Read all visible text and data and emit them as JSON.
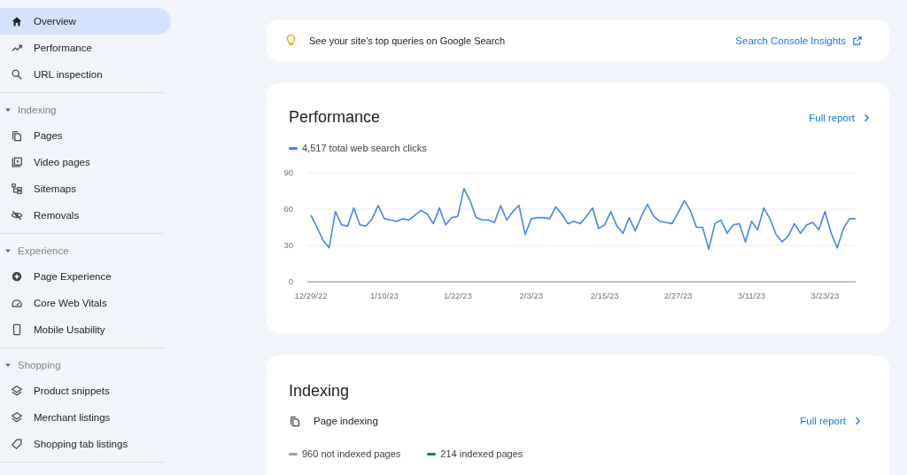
{
  "sidebar": {
    "sections": [
      {
        "items": [
          {
            "label": "Overview",
            "selected": true
          },
          {
            "label": "Performance",
            "selected": false
          },
          {
            "label": "URL inspection",
            "selected": false
          }
        ]
      },
      {
        "title": "Indexing",
        "expanded": true,
        "items": [
          {
            "label": "Pages",
            "selected": false
          },
          {
            "label": "Video pages",
            "selected": false
          },
          {
            "label": "Sitemaps",
            "selected": false
          },
          {
            "label": "Removals",
            "selected": false
          }
        ]
      },
      {
        "title": "Experience",
        "expanded": true,
        "items": [
          {
            "label": "Page Experience",
            "selected": false
          },
          {
            "label": "Core Web Vitals",
            "selected": false
          },
          {
            "label": "Mobile Usability",
            "selected": false
          }
        ]
      },
      {
        "title": "Shopping",
        "expanded": true,
        "items": [
          {
            "label": "Product snippets",
            "selected": false
          },
          {
            "label": "Merchant listings",
            "selected": false
          },
          {
            "label": "Shopping tab listings",
            "selected": false
          }
        ]
      }
    ]
  },
  "insights_banner": {
    "text": "See your site's top queries on Google Search",
    "link": "Search Console Insights"
  },
  "performance": {
    "title": "Performance",
    "link": "Full report",
    "chart_data": {
      "type": "line",
      "categories": [
        "12/29/22",
        null,
        null,
        null,
        null,
        null,
        null,
        null,
        null,
        null,
        null,
        null,
        "1/10/23",
        null,
        null,
        null,
        null,
        null,
        null,
        null,
        null,
        null,
        null,
        null,
        "1/22/23",
        null,
        null,
        null,
        null,
        null,
        null,
        null,
        null,
        null,
        null,
        null,
        "2/3/23",
        null,
        null,
        null,
        null,
        null,
        null,
        null,
        null,
        null,
        null,
        null,
        "2/15/23",
        null,
        null,
        null,
        null,
        null,
        null,
        null,
        null,
        null,
        null,
        null,
        "2/27/23",
        null,
        null,
        null,
        null,
        null,
        null,
        null,
        null,
        null,
        null,
        null,
        "3/11/23",
        null,
        null,
        null,
        null,
        null,
        null,
        null,
        null,
        null,
        null,
        null,
        "3/23/23",
        null,
        null,
        null,
        null,
        null
      ],
      "series": [
        {
          "name": "4,517 total web search clicks",
          "color": "#4285f4",
          "values": [
            55,
            45,
            34,
            28,
            58,
            47,
            46,
            61,
            47,
            46,
            52,
            63,
            52,
            51,
            50,
            52,
            51,
            55,
            59,
            56,
            48,
            61,
            47,
            53,
            54,
            77,
            67,
            53,
            51,
            51,
            49,
            63,
            51,
            58,
            63,
            39,
            52,
            53,
            53,
            52,
            62,
            56,
            48,
            50,
            48,
            54,
            61,
            44,
            47,
            58,
            46,
            40,
            53,
            42,
            54,
            64,
            54,
            50,
            49,
            48,
            57,
            67,
            59,
            45,
            45,
            27,
            48,
            51,
            40,
            47,
            48,
            33,
            50,
            43,
            61,
            52,
            39,
            33,
            38,
            48,
            40,
            47,
            49,
            43,
            58,
            40,
            28,
            44,
            52,
            52
          ]
        }
      ],
      "ylim": [
        0,
        90
      ],
      "yticks": [
        0,
        30,
        60,
        90
      ]
    }
  },
  "indexing": {
    "title": "Indexing",
    "report": "Page indexing",
    "link": "Full report",
    "legend": [
      {
        "label": "960 not indexed pages",
        "color": "#9aa0a6"
      },
      {
        "label": "214 indexed pages",
        "color": "#188038"
      }
    ]
  }
}
